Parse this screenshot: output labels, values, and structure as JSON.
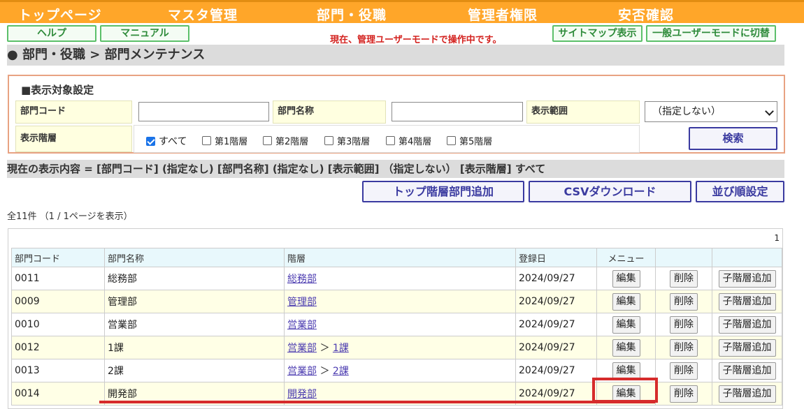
{
  "nav": [
    "トップページ",
    "マスタ管理",
    "部門・役職",
    "管理者権限",
    "安否確認"
  ],
  "buttons": {
    "help": "ヘルプ",
    "manual": "マニュアル",
    "sitemap": "サイトマップ表示",
    "general_mode": "一般ユーザーモードに切替"
  },
  "notice": "現在、管理ユーザーモードで操作中です。",
  "breadcrumb": "● 部門・役職 > 部門メンテナンス",
  "filter": {
    "title": "■表示対象設定",
    "dept_code_label": "部門コード",
    "dept_code_value": "",
    "dept_name_label": "部門名称",
    "dept_name_value": "",
    "range_label": "表示範囲",
    "range_value": "（指定しない）",
    "level_label": "表示階層",
    "levels": [
      {
        "label": "すべて",
        "checked": true
      },
      {
        "label": "第1階層",
        "checked": false
      },
      {
        "label": "第2階層",
        "checked": false
      },
      {
        "label": "第3階層",
        "checked": false
      },
      {
        "label": "第4階層",
        "checked": false
      },
      {
        "label": "第5階層",
        "checked": false
      }
    ],
    "search_button": "検索"
  },
  "status": "現在の表示内容 = [部門コード] (指定なし) [部門名称] (指定なし) [表示範囲] （指定しない） [表示階層] すべて",
  "actions": {
    "add_top": "トップ階層部門追加",
    "csv": "CSVダウンロード",
    "order": "並び順設定"
  },
  "count": "全11件 （1 / 1ページを表示）",
  "page_number": "1",
  "table": {
    "headers": [
      "部門コード",
      "部門名称",
      "階層",
      "登録日",
      "メニュー",
      "",
      ""
    ],
    "edit_label": "編集",
    "delete_label": "削除",
    "add_child_label": "子階層追加",
    "rows": [
      {
        "code": "0011",
        "name": "総務部",
        "hier": [
          {
            "text": "総務部",
            "link": true
          }
        ],
        "date": "2024/09/27"
      },
      {
        "code": "0009",
        "name": "管理部",
        "hier": [
          {
            "text": "管理部",
            "link": true
          }
        ],
        "date": "2024/09/27"
      },
      {
        "code": "0010",
        "name": "営業部",
        "hier": [
          {
            "text": "営業部",
            "link": true
          }
        ],
        "date": "2024/09/27"
      },
      {
        "code": "0012",
        "name": "1課",
        "hier": [
          {
            "text": "営業部",
            "link": true
          },
          {
            "text": " ＞ ",
            "link": false
          },
          {
            "text": "1課",
            "link": true
          }
        ],
        "date": "2024/09/27"
      },
      {
        "code": "0013",
        "name": "2課",
        "hier": [
          {
            "text": "営業部",
            "link": true
          },
          {
            "text": " ＞ ",
            "link": false
          },
          {
            "text": "2課",
            "link": true
          }
        ],
        "date": "2024/09/27"
      },
      {
        "code": "0014",
        "name": "開発部",
        "hier": [
          {
            "text": "開発部",
            "link": true
          }
        ],
        "date": "2024/09/27"
      }
    ]
  },
  "colors": {
    "nav": "#ffa629",
    "highlight": "#d62b2b",
    "primary": "#3a3aa0",
    "green": "#5cc06a"
  }
}
